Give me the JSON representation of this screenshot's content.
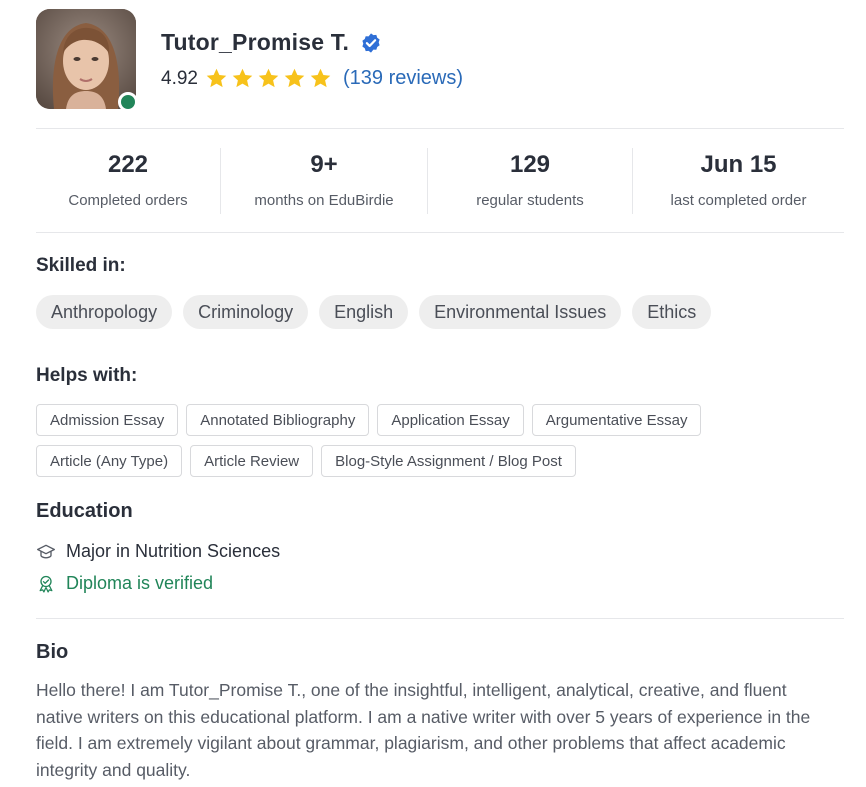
{
  "profile": {
    "name": "Tutor_Promise T.",
    "rating": "4.92",
    "stars": 5,
    "reviews": "(139 reviews)",
    "online": true
  },
  "stats": [
    {
      "value": "222",
      "label": "Completed orders"
    },
    {
      "value": "9+",
      "label": "months on EduBirdie"
    },
    {
      "value": "129",
      "label": "regular students"
    },
    {
      "value": "Jun 15",
      "label": "last completed order"
    }
  ],
  "skilled": {
    "title": "Skilled in:",
    "items": [
      "Anthropology",
      "Criminology",
      "English",
      "Environmental Issues",
      "Ethics"
    ]
  },
  "helps": {
    "title": "Helps with:",
    "items": [
      "Admission Essay",
      "Annotated Bibliography",
      "Application Essay",
      "Argumentative Essay",
      "Article (Any Type)",
      "Article Review",
      "Blog-Style Assignment / Blog Post"
    ]
  },
  "education": {
    "title": "Education",
    "major": "Major in Nutrition Sciences",
    "verified": "Diploma is verified",
    "icons": [
      "graduation-cap-icon",
      "award-badge-icon"
    ]
  },
  "bio": {
    "title": "Bio",
    "text": "Hello there! I am Tutor_Promise T., one of the insightful, intelligent, analytical, creative, and fluent native writers on this educational platform. I am a native writer with over 5 years of experience in the field. I am extremely vigilant about grammar, plagiarism, and other problems that affect academic integrity and quality."
  },
  "colors": {
    "accent_blue": "#2a6ab8",
    "verified_blue": "#2f6fd6",
    "star_yellow": "#f7c21b",
    "online_green": "#218559",
    "text_dark": "#2a2f3a",
    "text_muted": "#575c66",
    "chip_bg": "#eeeeee"
  }
}
